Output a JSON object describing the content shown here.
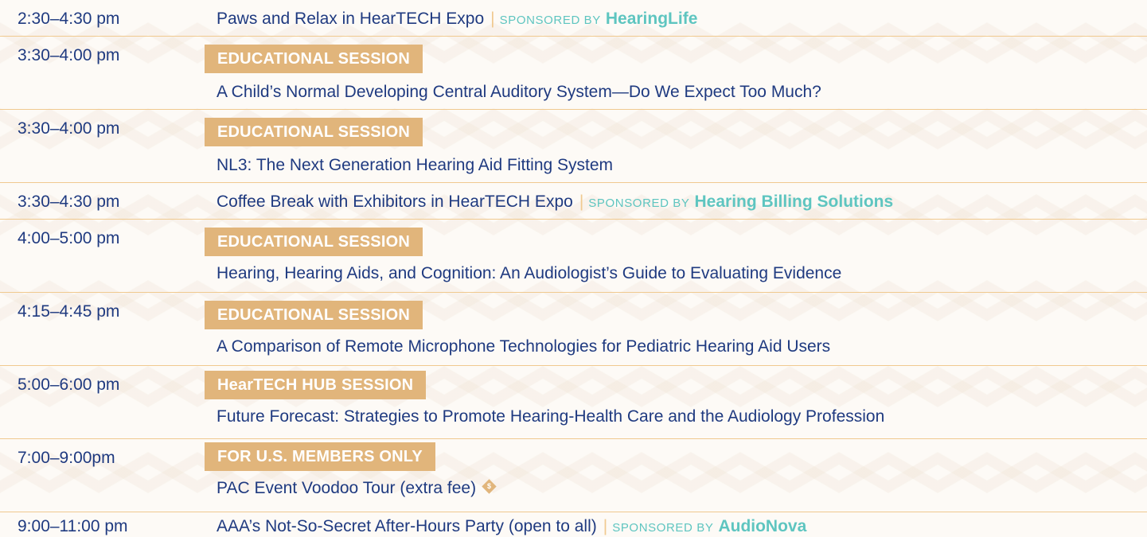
{
  "schedule": [
    {
      "time": "2:30–4:30 pm",
      "title": "Paws and Relax in HearTECH Expo",
      "sponsor_label": "SPONSORED BY",
      "sponsor": "HearingLife"
    },
    {
      "time": "3:30–4:00 pm",
      "badge": "EDUCATIONAL SESSION",
      "title": "A Child’s Normal Developing Central Auditory System—Do We Expect Too Much?"
    },
    {
      "time": "3:30–4:00 pm",
      "badge": "EDUCATIONAL SESSION",
      "title": "NL3: The Next Generation Hearing Aid Fitting System"
    },
    {
      "time": "3:30–4:30 pm",
      "title": "Coffee Break with Exhibitors in HearTECH Expo",
      "sponsor_label": "SPONSORED BY",
      "sponsor": "Hearing Billing Solutions"
    },
    {
      "time": "4:00–5:00 pm",
      "badge": "EDUCATIONAL SESSION",
      "title": "Hearing, Hearing Aids, and Cognition: An Audiologist’s Guide to Evaluating Evidence"
    },
    {
      "time": "4:15–4:45 pm",
      "badge": "EDUCATIONAL SESSION",
      "title": "A Comparison of Remote Microphone Technologies for Pediatric Hearing Aid Users"
    },
    {
      "time": "5:00–6:00 pm",
      "badge": "HearTECH HUB SESSION",
      "title": "Future Forecast: Strategies to Promote Hearing-Health Care and the Audiology Profession"
    },
    {
      "time": "7:00–9:00pm",
      "badge": "FOR U.S. MEMBERS ONLY",
      "title": "PAC Event Voodoo Tour (extra fee)",
      "fee_icon": "dollar-diamond-icon",
      "fee_symbol": "$"
    },
    {
      "time": "9:00–11:00 pm",
      "title": "AAA’s Not-So-Secret After-Hours Party (open to all)",
      "sponsor_label": "SPONSORED BY",
      "sponsor": "AudioNova"
    }
  ],
  "colors": {
    "text": "#1f3a80",
    "accent_teal": "#5ec5c0",
    "badge_tan": "#e1b57b",
    "rule": "#f0c98f",
    "background": "#fdfaf6"
  }
}
